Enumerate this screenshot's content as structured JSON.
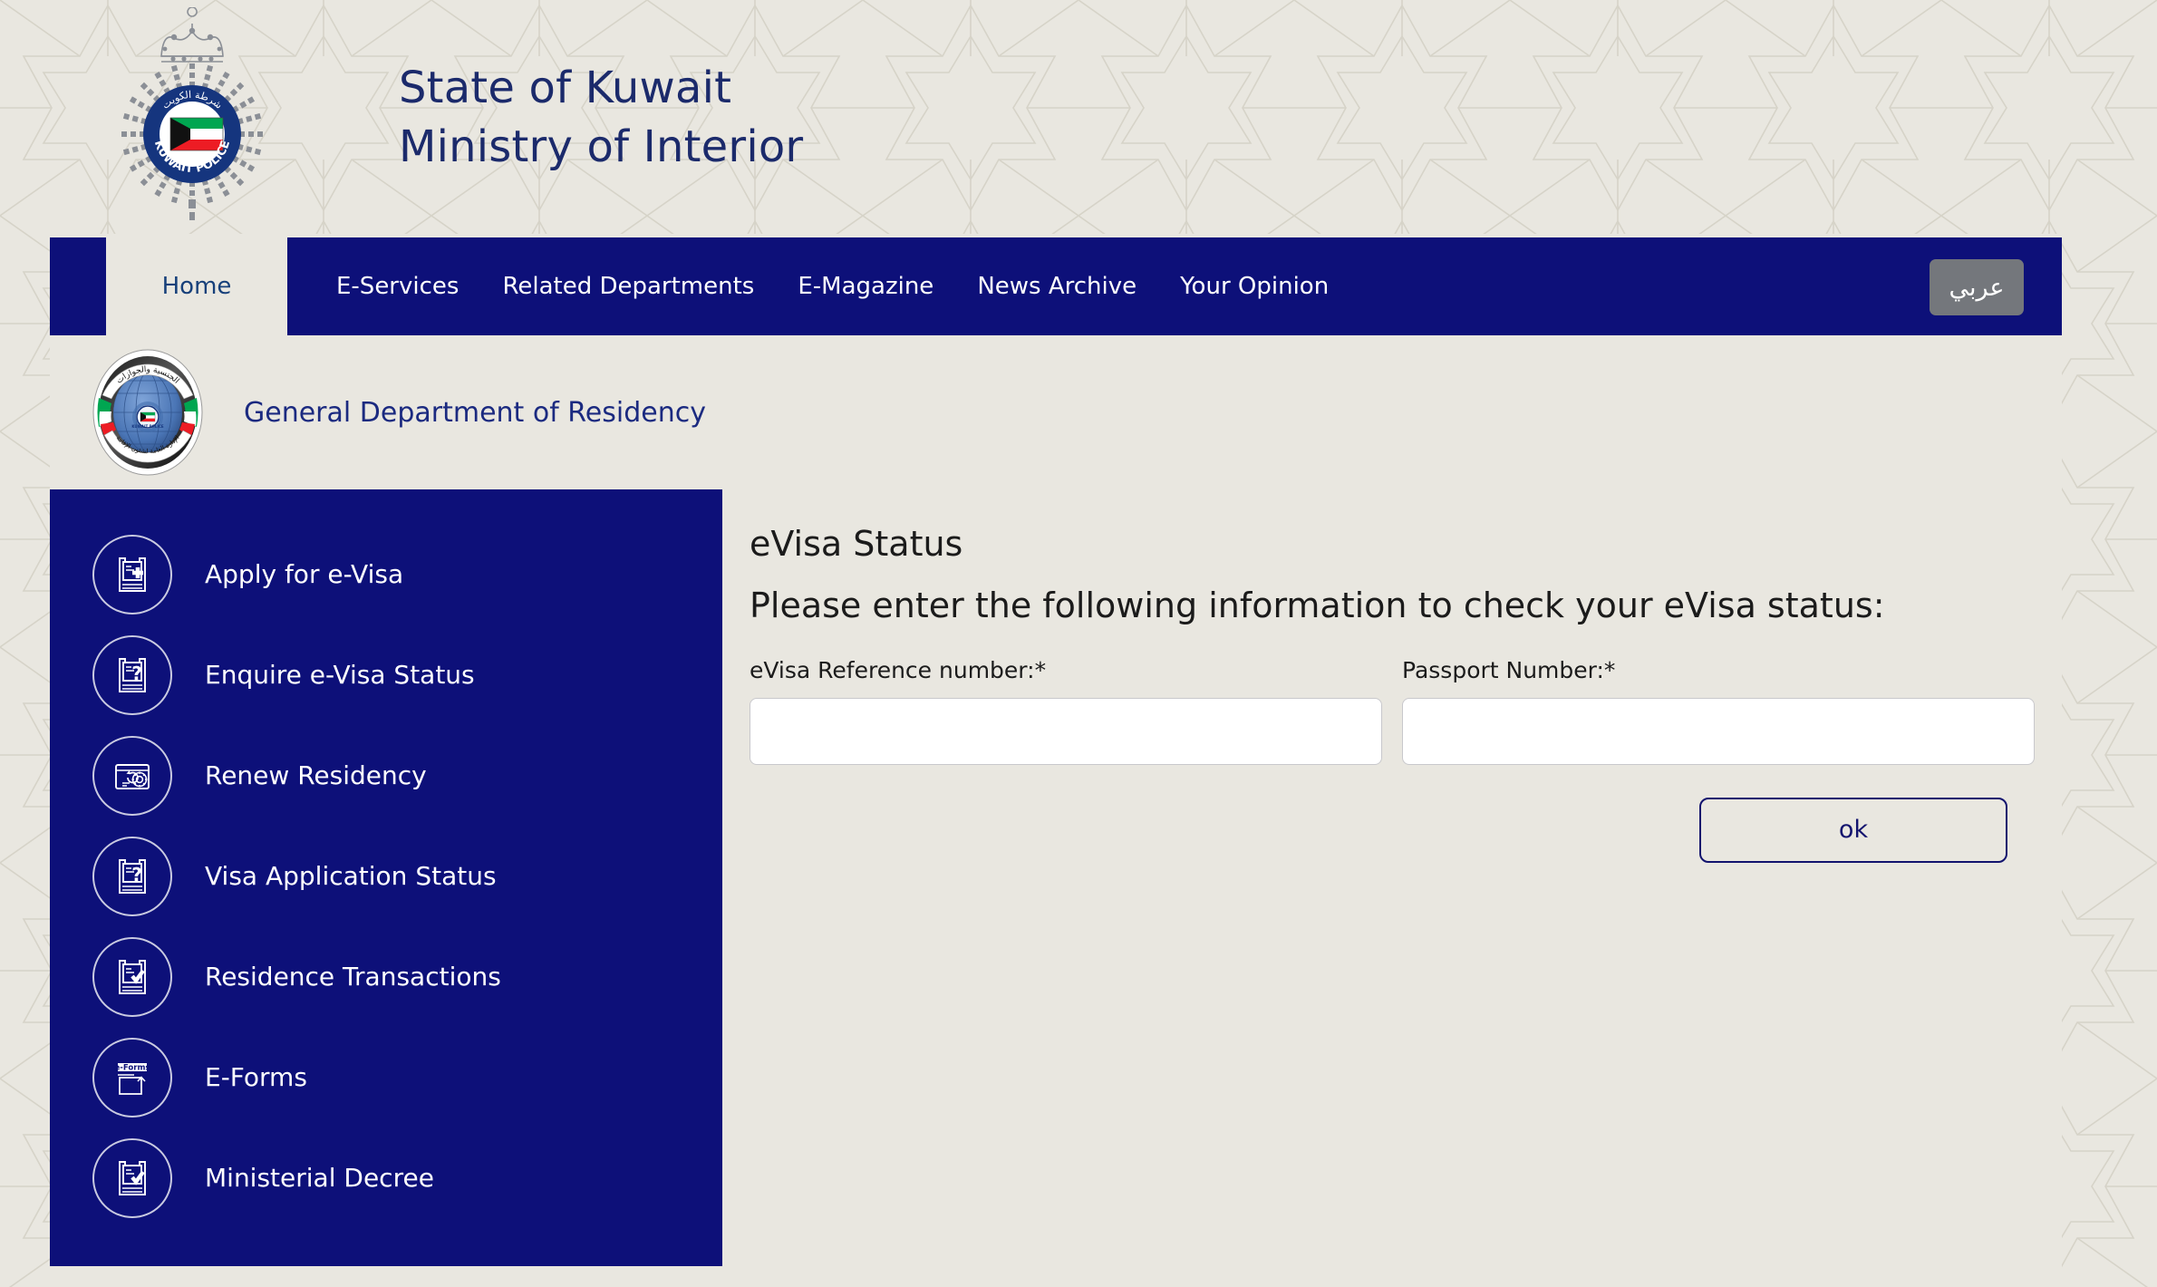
{
  "masthead": {
    "crest_icon": "kuwait-police-emblem",
    "title_line1": "State of Kuwait",
    "title_line2": "Ministry of Interior"
  },
  "nav": {
    "items": [
      {
        "label": "Home",
        "active": true
      },
      {
        "label": "E-Services",
        "active": false
      },
      {
        "label": "Related Departments",
        "active": false
      },
      {
        "label": "E-Magazine",
        "active": false
      },
      {
        "label": "News Archive",
        "active": false
      },
      {
        "label": "Your Opinion",
        "active": false
      }
    ],
    "language_button": "عربي"
  },
  "department": {
    "logo_icon": "general-department-of-residency-emblem",
    "title": "General Department of Residency"
  },
  "sidebar": {
    "items": [
      {
        "label": "Apply for e-Visa",
        "icon": "document-plus-icon"
      },
      {
        "label": "Enquire e-Visa Status",
        "icon": "document-question-icon"
      },
      {
        "label": "Renew Residency",
        "icon": "id-card-refresh-icon"
      },
      {
        "label": "Visa Application Status",
        "icon": "document-question-icon"
      },
      {
        "label": "Residence Transactions",
        "icon": "document-check-icon"
      },
      {
        "label": "E-Forms",
        "icon": "e-forms-upload-icon"
      },
      {
        "label": "Ministerial Decree",
        "icon": "document-check-icon"
      }
    ]
  },
  "main": {
    "title": "eVisa Status",
    "subtitle": "Please enter the following information to check your eVisa status:",
    "fields": [
      {
        "label": "eVisa Reference number:*",
        "value": "",
        "placeholder": ""
      },
      {
        "label": "Passport Number:*",
        "value": "",
        "placeholder": ""
      }
    ],
    "submit_label": "ok"
  },
  "colors": {
    "navy": "#0d1079",
    "page_bg": "#e9e7e0",
    "title_blue": "#1b2a6b",
    "lang_button_gray": "#74777c",
    "active_tab_text": "#17407a"
  }
}
